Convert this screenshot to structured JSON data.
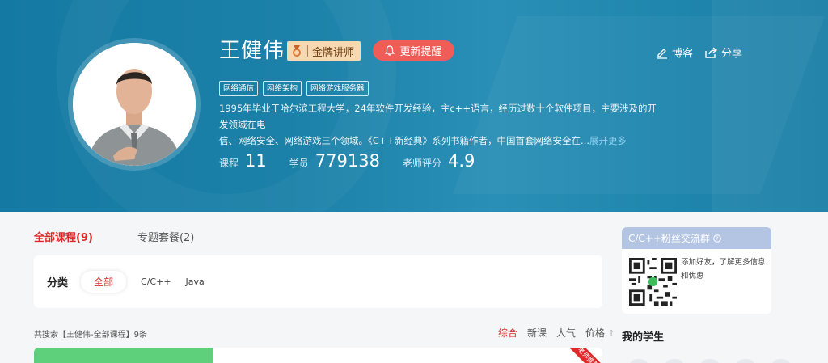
{
  "teacher": {
    "name": "王健伟",
    "badge_label": "金牌讲师",
    "remind_label": "更新提醒",
    "tags": [
      "网络通信",
      "网络架构",
      "网络游戏服务器"
    ],
    "intro_line1": "1995年毕业于哈尔滨工程大学，24年软件开发经验，主c++语言，经历过数十个软件项目，主要涉及的开发领域在电",
    "intro_line2": "信、网络安全、网络游戏三个领域。《C++新经典》系列书籍作者，中国首套网络安全在...",
    "intro_more": "展开更多",
    "stats": {
      "courses_label": "课程",
      "courses_value": "11",
      "students_label": "学员",
      "students_value": "779138",
      "rating_label": "老师评分",
      "rating_value": "4.9"
    }
  },
  "top_links": {
    "blog": "博客",
    "share": "分享"
  },
  "tabs": {
    "all": "全部课程(9)",
    "packages": "专题套餐(2)"
  },
  "filter": {
    "label": "分类",
    "options": [
      "全部",
      "C/C++",
      "Java"
    ]
  },
  "results": {
    "count_text": "共搜索【王健伟-全部课程】9条",
    "sort": [
      "综合",
      "新课",
      "人气",
      "价格"
    ]
  },
  "course_card": {
    "ribbon": "老师推荐"
  },
  "sidebar": {
    "group_title": "C/C++粉丝交流群",
    "group_text": "添加好友，了解更多信息和优惠",
    "students_title": "我的学生"
  },
  "colors": {
    "accent": "#e0292a",
    "banner": "#1c81a8",
    "remind": "#f05d58",
    "gold": "#f6d8b1"
  }
}
